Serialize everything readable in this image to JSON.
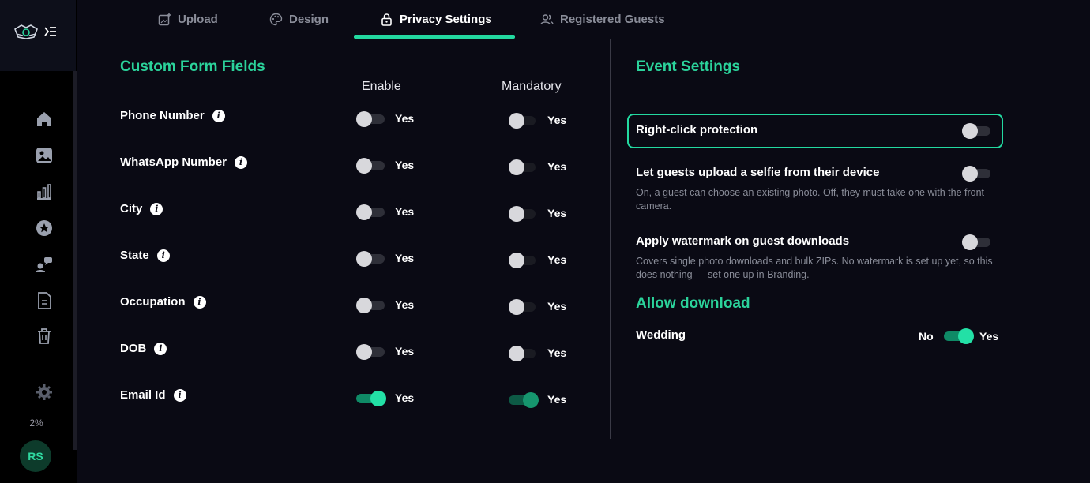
{
  "sidebar": {
    "usage": "2%",
    "avatar_initials": "RS",
    "icons": [
      "home-icon",
      "gallery-icon",
      "analytics-icon",
      "favorites-icon",
      "guests-icon",
      "document-icon",
      "trash-icon",
      "settings-icon"
    ]
  },
  "tabs": [
    {
      "label": "Upload",
      "icon": "upload-icon",
      "active": false
    },
    {
      "label": "Design",
      "icon": "palette-icon",
      "active": false
    },
    {
      "label": "Privacy Settings",
      "icon": "lock-icon",
      "active": true
    },
    {
      "label": "Registered Guests",
      "icon": "users-icon",
      "active": false
    }
  ],
  "form": {
    "title": "Custom Form Fields",
    "col_enable": "Enable",
    "col_mandatory": "Mandatory",
    "fields": [
      {
        "label": "Phone Number",
        "enable": false,
        "enable_text": "Yes",
        "mandatory": false,
        "mandatory_text": "Yes"
      },
      {
        "label": "WhatsApp Number",
        "enable": false,
        "enable_text": "Yes",
        "mandatory": false,
        "mandatory_text": "Yes"
      },
      {
        "label": "City",
        "enable": false,
        "enable_text": "Yes",
        "mandatory": false,
        "mandatory_text": "Yes"
      },
      {
        "label": "State",
        "enable": false,
        "enable_text": "Yes",
        "mandatory": false,
        "mandatory_text": "Yes"
      },
      {
        "label": "Occupation",
        "enable": false,
        "enable_text": "Yes",
        "mandatory": false,
        "mandatory_text": "Yes"
      },
      {
        "label": "DOB",
        "enable": false,
        "enable_text": "Yes",
        "mandatory": false,
        "mandatory_text": "Yes"
      },
      {
        "label": "Email Id",
        "enable": true,
        "enable_text": "Yes",
        "mandatory": true,
        "mandatory_text": "Yes"
      }
    ]
  },
  "event_settings": {
    "title": "Event Settings",
    "right_click": {
      "label": "Right-click protection",
      "on": false
    },
    "selfie": {
      "label": "Let guests upload a selfie from their device",
      "description": "On, a guest can choose an existing photo. Off, they must take one with the front camera.",
      "on": false
    },
    "watermark": {
      "label": "Apply watermark on guest downloads",
      "description": "Covers single photo downloads and bulk ZIPs. No watermark is set up yet, so this does nothing — set one up in Branding.",
      "on": false
    }
  },
  "allow_download": {
    "title": "Allow download",
    "item_label": "Wedding",
    "no_label": "No",
    "yes_label": "Yes",
    "on": true
  },
  "colors": {
    "accent": "#23d9a0",
    "title_green": "#2bd39b",
    "background": "#0a0a14"
  }
}
